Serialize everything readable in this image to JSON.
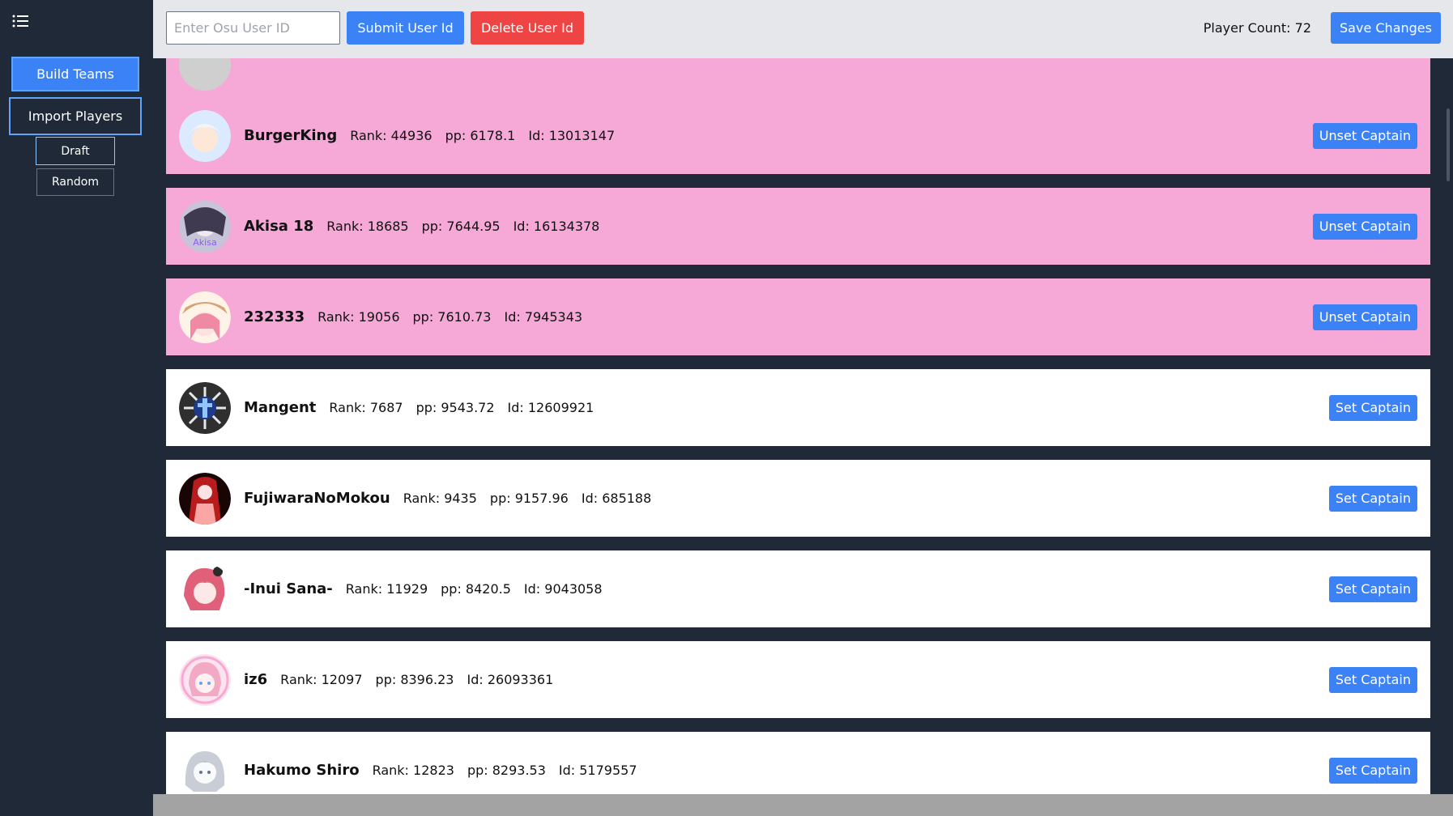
{
  "sidebar": {
    "build_teams": "Build Teams",
    "import_players": "Import Players",
    "draft": "Draft",
    "random": "Random"
  },
  "topbar": {
    "input_placeholder": "Enter Osu User ID",
    "submit_label": "Submit User Id",
    "delete_label": "Delete User Id",
    "player_count": "Player Count: 72",
    "save_label": "Save Changes"
  },
  "players": [
    {
      "name": "BurgerKing",
      "rank": "Rank: 44936",
      "pp": "pp: 6178.1",
      "id": "Id: 13013147",
      "button": "Unset Captain",
      "captain": true,
      "avatar_color": "#dbeafe"
    },
    {
      "name": "Akisa 18",
      "rank": "Rank: 18685",
      "pp": "pp: 7644.95",
      "id": "Id: 16134378",
      "button": "Unset Captain",
      "captain": true,
      "avatar_color": "#c7c3d8"
    },
    {
      "name": "232333",
      "rank": "Rank: 19056",
      "pp": "pp: 7610.73",
      "id": "Id: 7945343",
      "button": "Unset Captain",
      "captain": true,
      "avatar_color": "#f7c9b5"
    },
    {
      "name": "Mangent",
      "rank": "Rank: 7687",
      "pp": "pp: 9543.72",
      "id": "Id: 12609921",
      "button": "Set Captain",
      "captain": false,
      "avatar_color": "#2f2f2f"
    },
    {
      "name": "FujiwaraNoMokou",
      "rank": "Rank: 9435",
      "pp": "pp: 9157.96",
      "id": "Id: 685188",
      "button": "Set Captain",
      "captain": false,
      "avatar_color": "#7f1d1d"
    },
    {
      "name": "-Inui Sana-",
      "rank": "Rank: 11929",
      "pp": "pp: 8420.5",
      "id": "Id: 9043058",
      "button": "Set Captain",
      "captain": false,
      "avatar_color": "#e0607a"
    },
    {
      "name": "iz6",
      "rank": "Rank: 12097",
      "pp": "pp: 8396.23",
      "id": "Id: 26093361",
      "button": "Set Captain",
      "captain": false,
      "avatar_color": "#f2a9c4"
    },
    {
      "name": "Hakumo Shiro",
      "rank": "Rank: 12823",
      "pp": "pp: 8293.53",
      "id": "Id: 5179557",
      "button": "Set Captain",
      "captain": false,
      "avatar_color": "#c9ced6"
    }
  ]
}
